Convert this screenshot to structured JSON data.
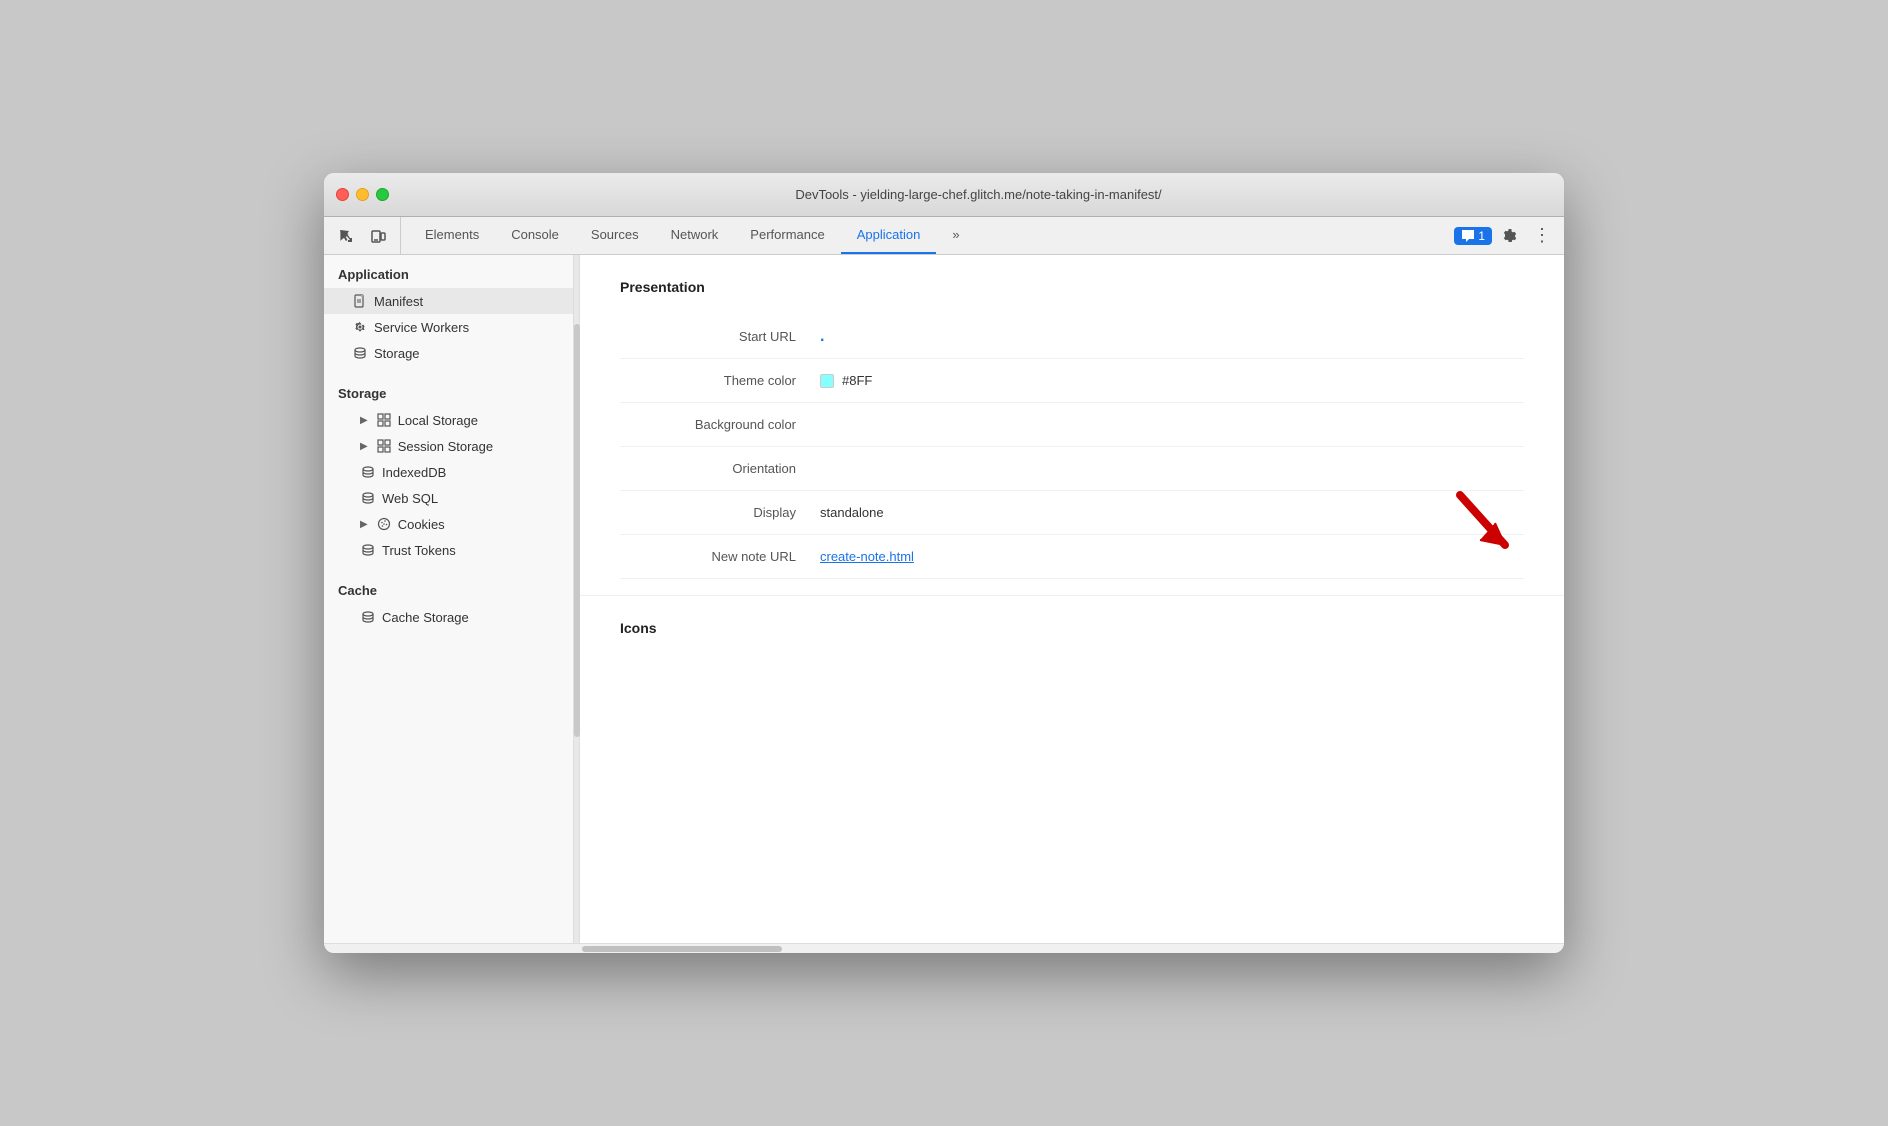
{
  "window": {
    "title": "DevTools - yielding-large-chef.glitch.me/note-taking-in-manifest/"
  },
  "toolbar": {
    "tabs": [
      {
        "label": "Elements",
        "active": false
      },
      {
        "label": "Console",
        "active": false
      },
      {
        "label": "Sources",
        "active": false
      },
      {
        "label": "Network",
        "active": false
      },
      {
        "label": "Performance",
        "active": false
      },
      {
        "label": "Application",
        "active": true
      }
    ],
    "more_label": "»",
    "chat_count": "1",
    "settings_icon": "⚙",
    "more_vert_icon": "⋮",
    "inspect_icon": "cursor",
    "device_icon": "device"
  },
  "sidebar": {
    "application_section": "Application",
    "items_application": [
      {
        "label": "Manifest",
        "icon": "file",
        "active": true
      },
      {
        "label": "Service Workers",
        "icon": "gear"
      },
      {
        "label": "Storage",
        "icon": "db"
      }
    ],
    "storage_section": "Storage",
    "items_storage": [
      {
        "label": "Local Storage",
        "icon": "grid",
        "has_arrow": true
      },
      {
        "label": "Session Storage",
        "icon": "grid",
        "has_arrow": true
      },
      {
        "label": "IndexedDB",
        "icon": "db"
      },
      {
        "label": "Web SQL",
        "icon": "db"
      },
      {
        "label": "Cookies",
        "icon": "cookie",
        "has_arrow": true
      },
      {
        "label": "Trust Tokens",
        "icon": "db"
      }
    ],
    "cache_section": "Cache",
    "items_cache": [
      {
        "label": "Cache Storage",
        "icon": "db"
      }
    ]
  },
  "presentation": {
    "section_title": "Presentation",
    "rows": [
      {
        "label": "Start URL",
        "value": ".",
        "type": "dot"
      },
      {
        "label": "Theme color",
        "value": "#8FF",
        "type": "color",
        "color": "#88ffff"
      },
      {
        "label": "Background color",
        "value": "",
        "type": "text"
      },
      {
        "label": "Orientation",
        "value": "",
        "type": "text"
      },
      {
        "label": "Display",
        "value": "standalone",
        "type": "text"
      },
      {
        "label": "New note URL",
        "value": "create-note.html",
        "type": "link"
      }
    ]
  },
  "icons_section": {
    "title": "Icons"
  }
}
